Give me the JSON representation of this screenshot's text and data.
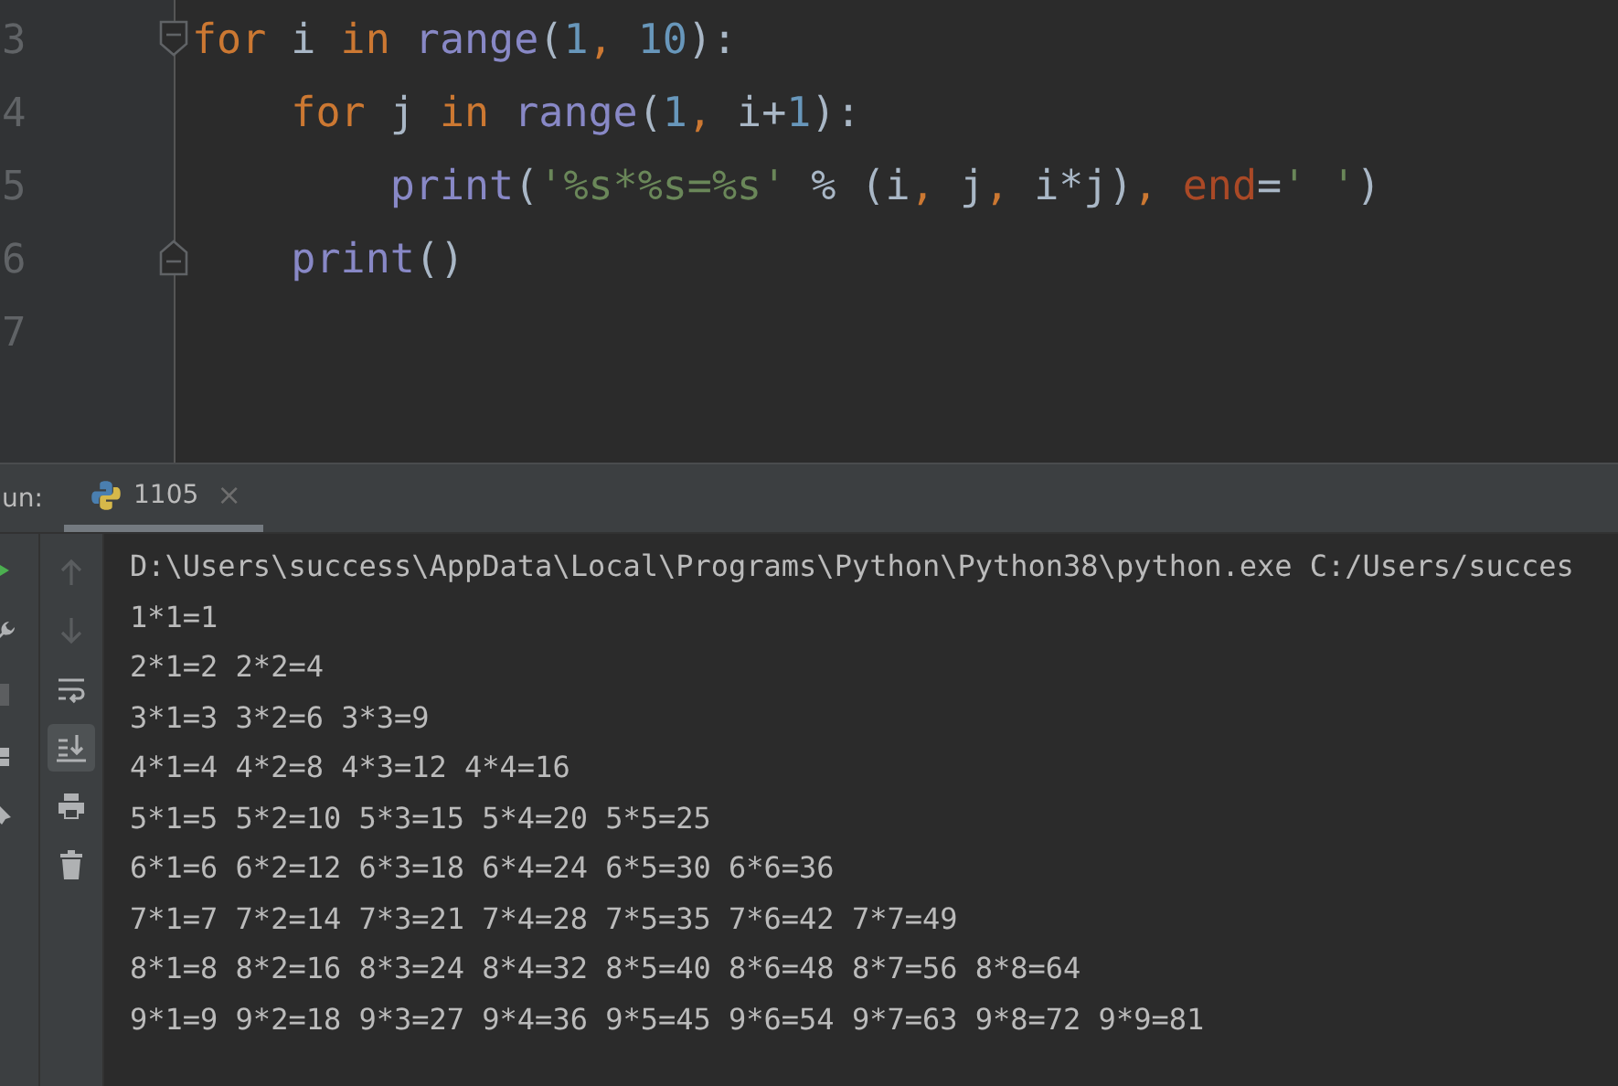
{
  "editor": {
    "lines": [
      {
        "number": "3",
        "kind": "fold-start",
        "tokens": [
          {
            "text": "for",
            "kind": "keyword"
          },
          {
            "text": " i ",
            "kind": "plain"
          },
          {
            "text": "in",
            "kind": "keyword"
          },
          {
            "text": " range",
            "kind": "builtin"
          },
          {
            "text": "(",
            "kind": "plain"
          },
          {
            "text": "1",
            "kind": "number"
          },
          {
            "text": ", ",
            "kind": "comma"
          },
          {
            "text": "10",
            "kind": "number"
          },
          {
            "text": "):",
            "kind": "plain"
          }
        ]
      },
      {
        "number": "4",
        "kind": "plain",
        "tokens": [
          {
            "text": "    for",
            "kind": "keyword"
          },
          {
            "text": " j ",
            "kind": "plain"
          },
          {
            "text": "in",
            "kind": "keyword"
          },
          {
            "text": " range",
            "kind": "builtin"
          },
          {
            "text": "(",
            "kind": "plain"
          },
          {
            "text": "1",
            "kind": "number"
          },
          {
            "text": ", ",
            "kind": "comma"
          },
          {
            "text": "i+",
            "kind": "plain"
          },
          {
            "text": "1",
            "kind": "number"
          },
          {
            "text": "):",
            "kind": "plain"
          }
        ]
      },
      {
        "number": "5",
        "kind": "plain",
        "tokens": [
          {
            "text": "        print",
            "kind": "builtin"
          },
          {
            "text": "(",
            "kind": "plain"
          },
          {
            "text": "'%s*%s=%s'",
            "kind": "string"
          },
          {
            "text": " % (i",
            "kind": "plain"
          },
          {
            "text": ", ",
            "kind": "comma"
          },
          {
            "text": "j",
            "kind": "plain"
          },
          {
            "text": ", ",
            "kind": "comma"
          },
          {
            "text": "i*j)",
            "kind": "plain"
          },
          {
            "text": ", ",
            "kind": "comma"
          },
          {
            "text": "end",
            "kind": "param"
          },
          {
            "text": "=",
            "kind": "plain"
          },
          {
            "text": "' '",
            "kind": "string"
          },
          {
            "text": ")",
            "kind": "plain"
          }
        ]
      },
      {
        "number": "6",
        "kind": "fold-end",
        "tokens": [
          {
            "text": "    print",
            "kind": "builtin"
          },
          {
            "text": "()",
            "kind": "plain"
          }
        ]
      },
      {
        "number": "7",
        "kind": "plain"
      }
    ]
  },
  "run_panel": {
    "label": "un:",
    "tabs": [
      {
        "title": "1105",
        "selected": true,
        "close": "×"
      }
    ],
    "left_toolbar": [
      {
        "kind": "run"
      },
      {
        "kind": "wrench"
      },
      {
        "kind": "stop"
      },
      {
        "kind": "layout"
      },
      {
        "kind": "pin"
      }
    ],
    "right_toolbar": [
      {
        "kind": "up",
        "on": false,
        "disabled": true
      },
      {
        "kind": "down",
        "on": false,
        "disabled": true
      },
      {
        "kind": "wrap",
        "on": false,
        "disabled": false
      },
      {
        "kind": "scroll-end",
        "on": true,
        "disabled": false
      },
      {
        "kind": "print",
        "on": false,
        "disabled": false
      },
      {
        "kind": "trash",
        "on": false,
        "disabled": false
      }
    ],
    "console": [
      "D:\\Users\\success\\AppData\\Local\\Programs\\Python\\Python38\\python.exe C:/Users/succes",
      "1*1=1",
      "2*1=2 2*2=4",
      "3*1=3 3*2=6 3*3=9",
      "4*1=4 4*2=8 4*3=12 4*4=16",
      "5*1=5 5*2=10 5*3=15 5*4=20 5*5=25",
      "6*1=6 6*2=12 6*3=18 6*4=24 6*5=30 6*6=36",
      "7*1=7 7*2=14 7*3=21 7*4=28 7*5=35 7*6=42 7*7=49",
      "8*1=8 8*2=16 8*3=24 8*4=32 8*5=40 8*6=48 8*7=56 8*8=64",
      "9*1=9 9*2=18 9*3=27 9*4=36 9*5=45 9*6=54 9*7=63 9*8=72 9*9=81"
    ]
  }
}
